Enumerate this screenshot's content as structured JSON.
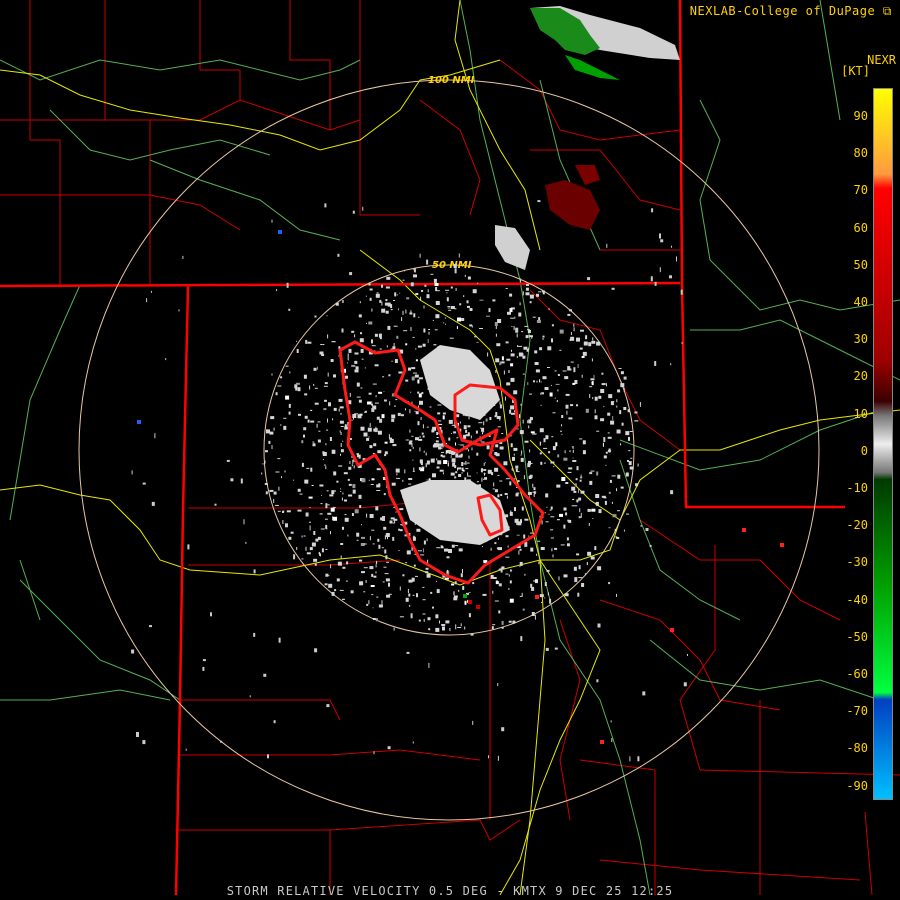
{
  "credit": "NEXLAB-College of DuPage",
  "product_code": "NEXR",
  "units": "[KT]",
  "range_rings": [
    {
      "label": "100 NMI"
    },
    {
      "label": "50 NMI"
    }
  ],
  "legend": {
    "ticks": [
      "90",
      "80",
      "70",
      "60",
      "50",
      "40",
      "30",
      "20",
      "10",
      "0",
      "-10",
      "-20",
      "-30",
      "-40",
      "-50",
      "-60",
      "-70",
      "-80",
      "-90"
    ]
  },
  "footer": "STORM RELATIVE VELOCITY 0.5 DEG - KMTX 9 DEC 25 12:25",
  "colors": {
    "background": "#000000",
    "state_border": "#ff0000",
    "county_border": "#cc0000",
    "highway": "#f0f000",
    "river": "#66cc66",
    "range_ring": "#e8c8a0",
    "warning_polygon": "#ff1a1a",
    "text": "#ffd200"
  }
}
